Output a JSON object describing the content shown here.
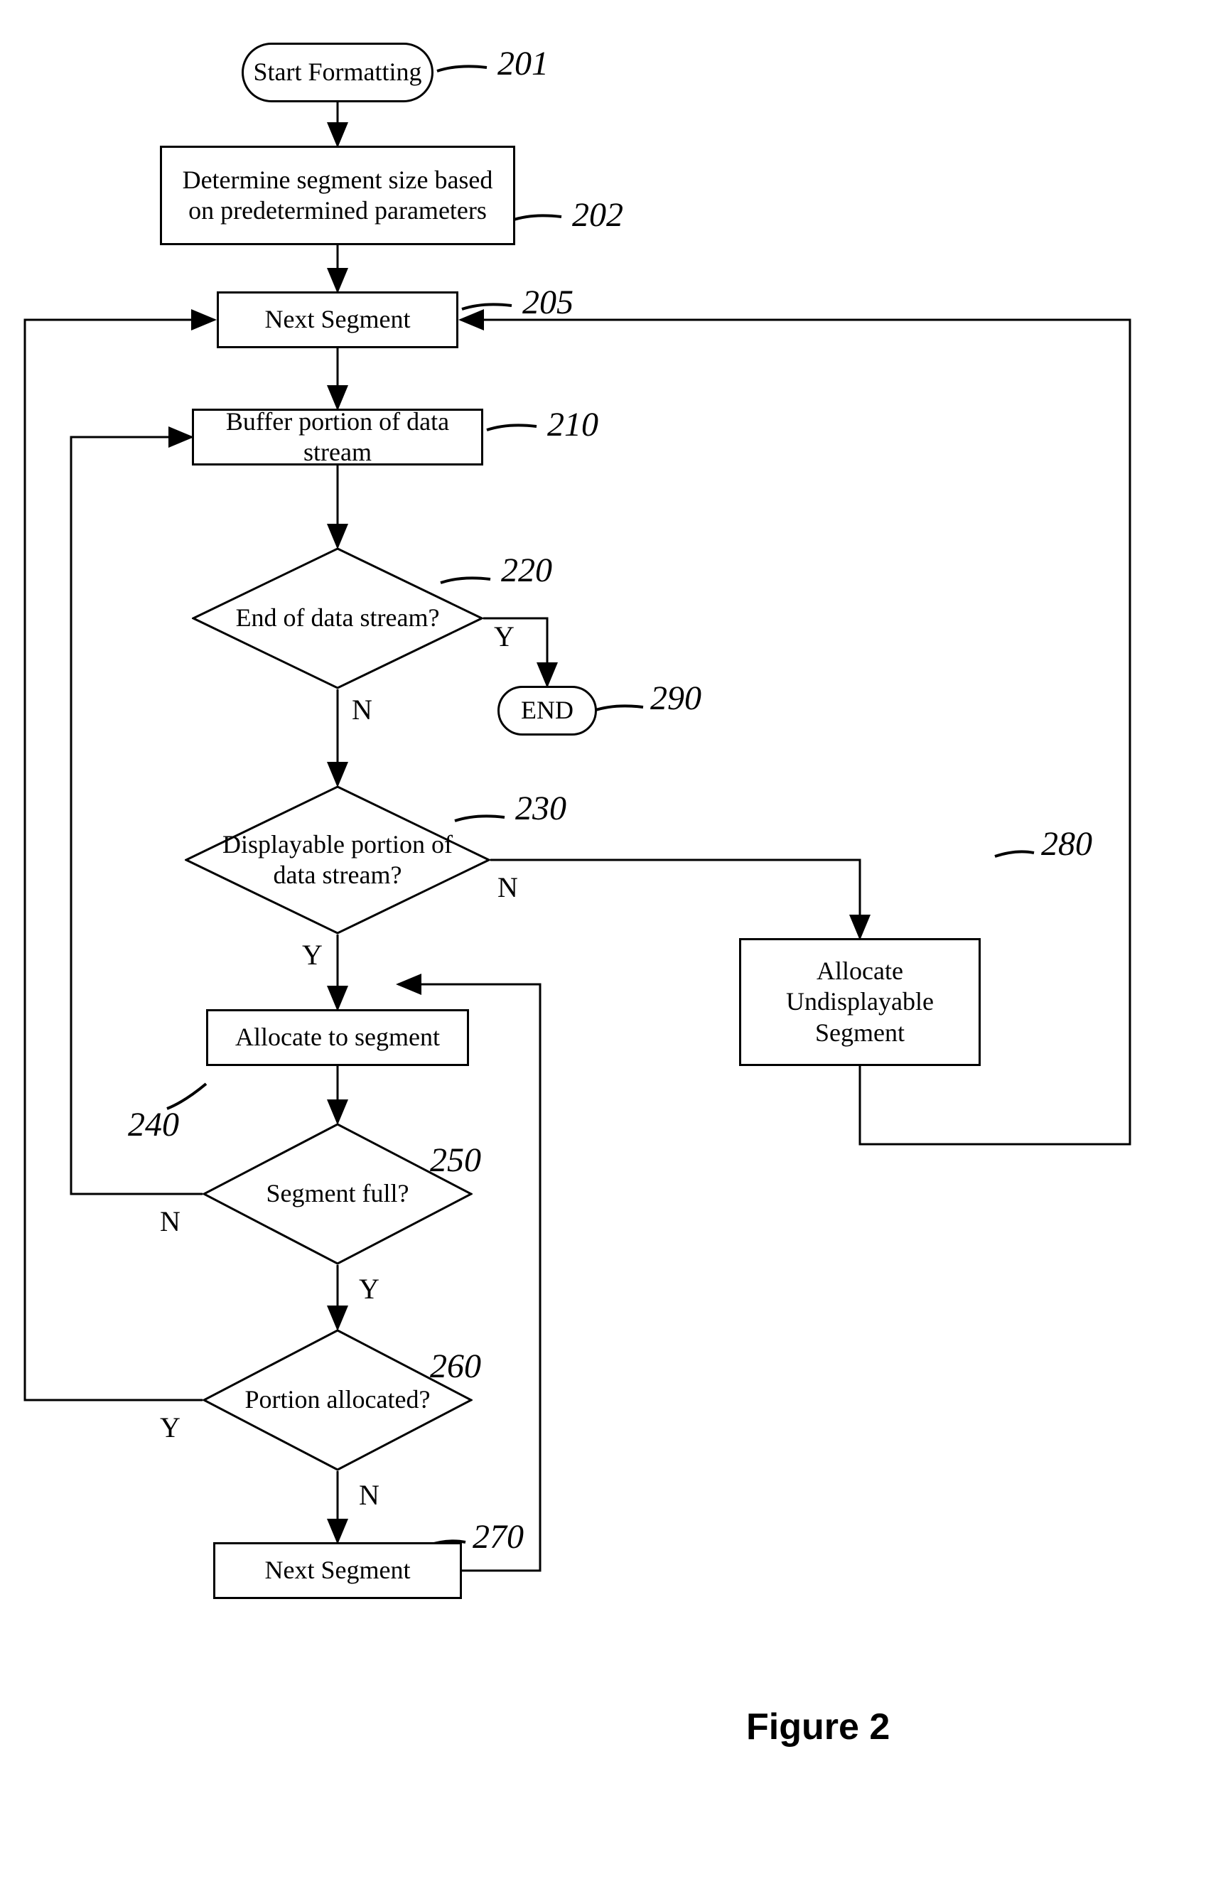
{
  "nodes": {
    "n201": "Start Formatting",
    "n202": "Determine segment size based on predetermined parameters",
    "n205": "Next Segment",
    "n210": "Buffer portion of data stream",
    "n220": "End of data stream?",
    "n290": "END",
    "n230": "Displayable portion of data stream?",
    "n240": "Allocate to segment",
    "n250": "Segment full?",
    "n260": "Portion allocated?",
    "n270": "Next Segment",
    "n280": "Allocate Undisplayable Segment"
  },
  "edgeLabels": {
    "d220Y": "Y",
    "d220N": "N",
    "d230Y": "Y",
    "d230N": "N",
    "d250Y": "Y",
    "d250N": "N",
    "d260Y": "Y",
    "d260N": "N"
  },
  "refs": {
    "r201": "201",
    "r202": "202",
    "r205": "205",
    "r210": "210",
    "r220": "220",
    "r290": "290",
    "r230": "230",
    "r240": "240",
    "r250": "250",
    "r260": "260",
    "r270": "270",
    "r280": "280"
  },
  "figure": "Figure 2"
}
